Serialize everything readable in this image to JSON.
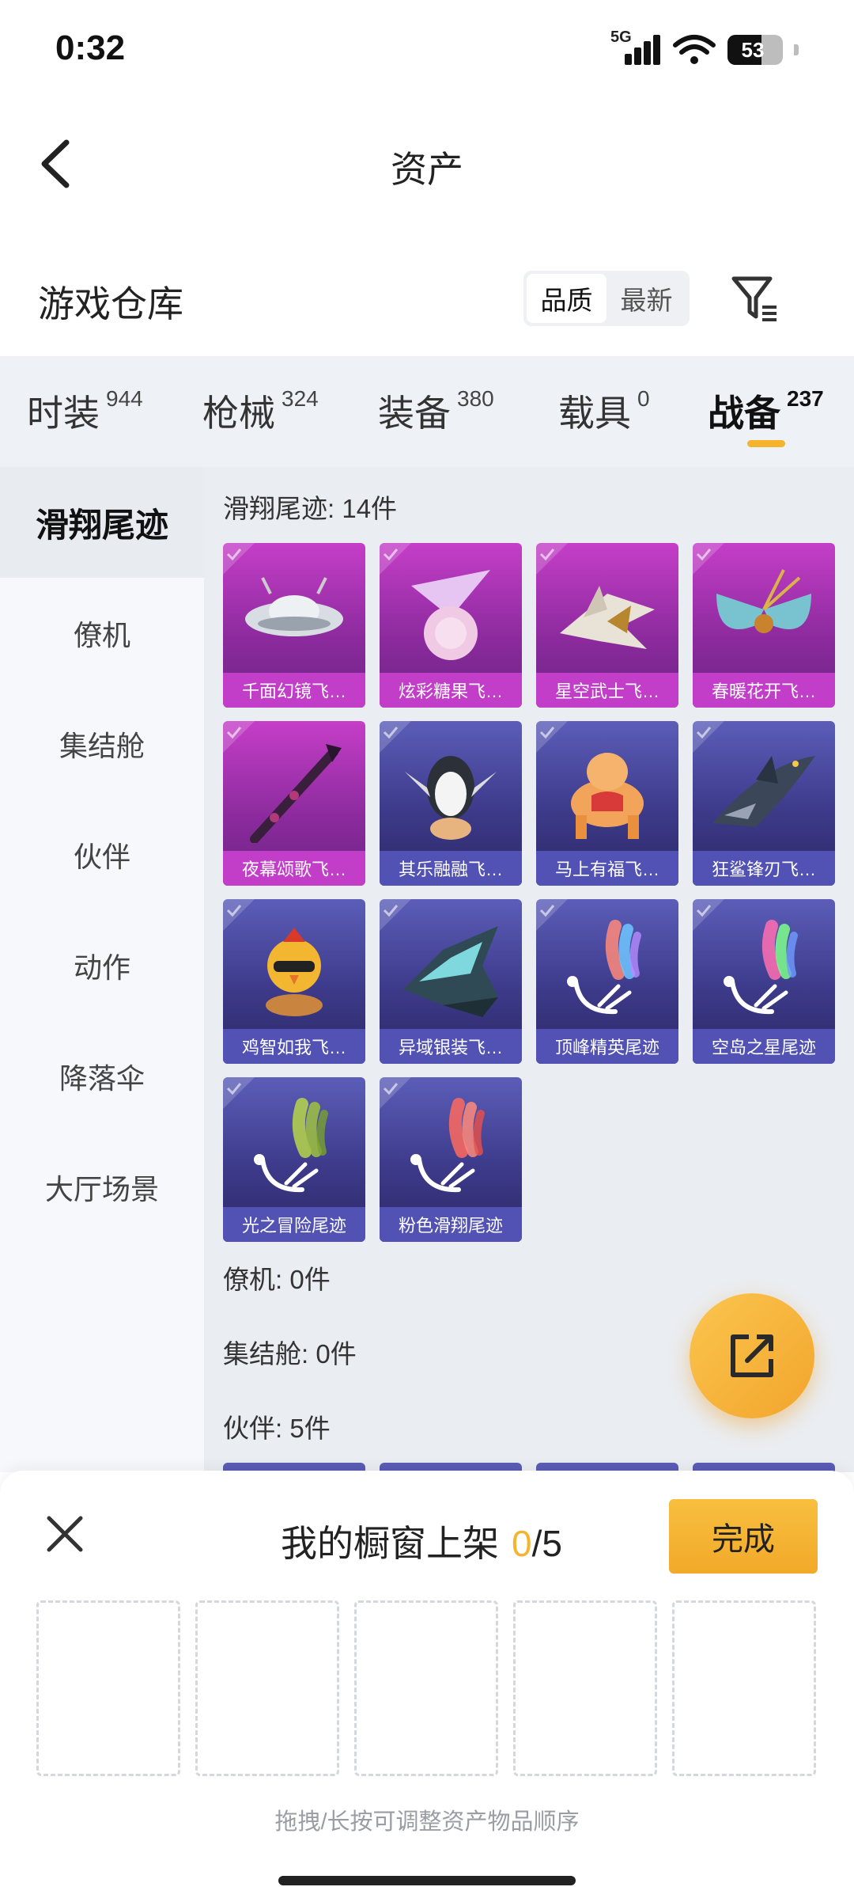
{
  "status": {
    "time": "0:32",
    "network": "5G",
    "battery": "53"
  },
  "nav": {
    "title": "资产"
  },
  "warehouse": {
    "title": "游戏仓库",
    "sort_options": [
      "品质",
      "最新"
    ],
    "active_sort": "品质"
  },
  "tabs": [
    {
      "label": "时装",
      "count": "944"
    },
    {
      "label": "枪械",
      "count": "324"
    },
    {
      "label": "装备",
      "count": "380"
    },
    {
      "label": "载具",
      "count": "0"
    },
    {
      "label": "战备",
      "count": "237",
      "active": true
    }
  ],
  "sidebar": {
    "items": [
      {
        "label": "滑翔尾迹",
        "active": true
      },
      {
        "label": "僚机"
      },
      {
        "label": "集结舱"
      },
      {
        "label": "伙伴"
      },
      {
        "label": "动作"
      },
      {
        "label": "降落伞"
      },
      {
        "label": "大厅场景"
      }
    ]
  },
  "content": {
    "sections": [
      {
        "title": "滑翔尾迹: 14件"
      },
      {
        "title": "僚机: 0件"
      },
      {
        "title": "集结舱: 0件"
      },
      {
        "title": "伙伴: 5件"
      }
    ],
    "items": [
      {
        "name": "千面幻镜飞…",
        "rarity": "purple",
        "icon": "ufo-icon"
      },
      {
        "name": "炫彩糖果飞…",
        "rarity": "purple",
        "icon": "candy-icon"
      },
      {
        "name": "星空武士飞…",
        "rarity": "purple",
        "icon": "blade-wing-icon"
      },
      {
        "name": "春暖花开飞…",
        "rarity": "purple",
        "icon": "butterfly-icon"
      },
      {
        "name": "夜幕颂歌飞…",
        "rarity": "purple",
        "icon": "spear-icon"
      },
      {
        "name": "其乐融融飞…",
        "rarity": "blue",
        "icon": "penguin-icon"
      },
      {
        "name": "马上有福飞…",
        "rarity": "blue",
        "icon": "horse-icon"
      },
      {
        "name": "狂鲨锋刃飞…",
        "rarity": "blue",
        "icon": "shark-icon"
      },
      {
        "name": "鸡智如我飞…",
        "rarity": "blue",
        "icon": "chicken-icon"
      },
      {
        "name": "异域银装飞…",
        "rarity": "blue",
        "icon": "alien-wing-icon"
      },
      {
        "name": "顶峰精英尾迹",
        "rarity": "blue",
        "icon": "smoke-trail-icon",
        "smoke": [
          "#ff8a7a",
          "#6fc7ff",
          "#b58cff"
        ]
      },
      {
        "name": "空岛之星尾迹",
        "rarity": "blue",
        "icon": "smoke-trail-icon",
        "smoke": [
          "#ff6fb0",
          "#7dff8a",
          "#6f9cff"
        ]
      },
      {
        "name": "光之冒险尾迹",
        "rarity": "blue",
        "icon": "smoke-trail-icon",
        "smoke": [
          "#b7d64a",
          "#9fc23e",
          "#7aa12e"
        ]
      },
      {
        "name": "粉色滑翔尾迹",
        "rarity": "blue",
        "icon": "smoke-trail-icon",
        "smoke": [
          "#ff6a5e",
          "#ff8a7a",
          "#e8504a"
        ]
      }
    ]
  },
  "showcase": {
    "title": "我的橱窗上架",
    "current": "0",
    "total": "/5",
    "done_label": "完成",
    "hint": "拖拽/长按可调整资产物品顺序"
  },
  "colors": {
    "accent": "#f5b32e",
    "purple_card": "#c23ec9",
    "blue_card": "#5252b4"
  }
}
